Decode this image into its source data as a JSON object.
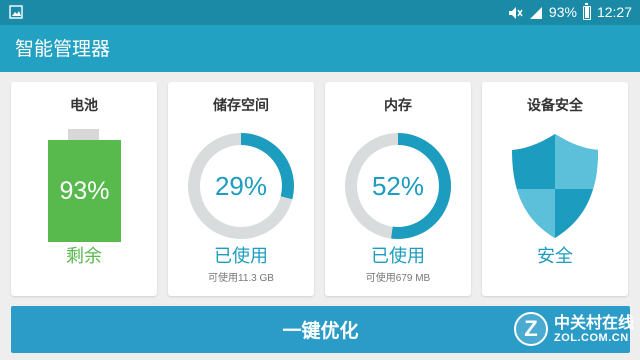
{
  "status_bar": {
    "battery_text": "93%",
    "time": "12:27",
    "icons": [
      "image-icon",
      "mute-icon",
      "signal-icon",
      "battery-icon"
    ]
  },
  "app": {
    "title": "智能管理器"
  },
  "cards": {
    "battery": {
      "title": "电池",
      "percent_label": "93%",
      "level": 0.93,
      "status": "剩余",
      "color": "#58b94d"
    },
    "storage": {
      "title": "储存空间",
      "percent_label": "29%",
      "fraction": 0.29,
      "status": "已使用",
      "detail": "可使用11.3 GB"
    },
    "memory": {
      "title": "内存",
      "percent_label": "52%",
      "fraction": 0.52,
      "status": "已使用",
      "detail": "可使用679 MB"
    },
    "security": {
      "title": "设备安全",
      "status": "安全",
      "icon": "shield-icon"
    }
  },
  "action": {
    "label": "一键优化"
  },
  "watermark": {
    "logo_letter": "Z",
    "cn": "中关村在线",
    "en": "ZOL.COM.CN"
  },
  "colors": {
    "status_bar": "#1b8aa6",
    "app_bar": "#22a1c2",
    "accent": "#1c9cbf",
    "ring_track": "#d9dcdc",
    "battery_green": "#58b94d",
    "button": "#2b9cc8"
  }
}
